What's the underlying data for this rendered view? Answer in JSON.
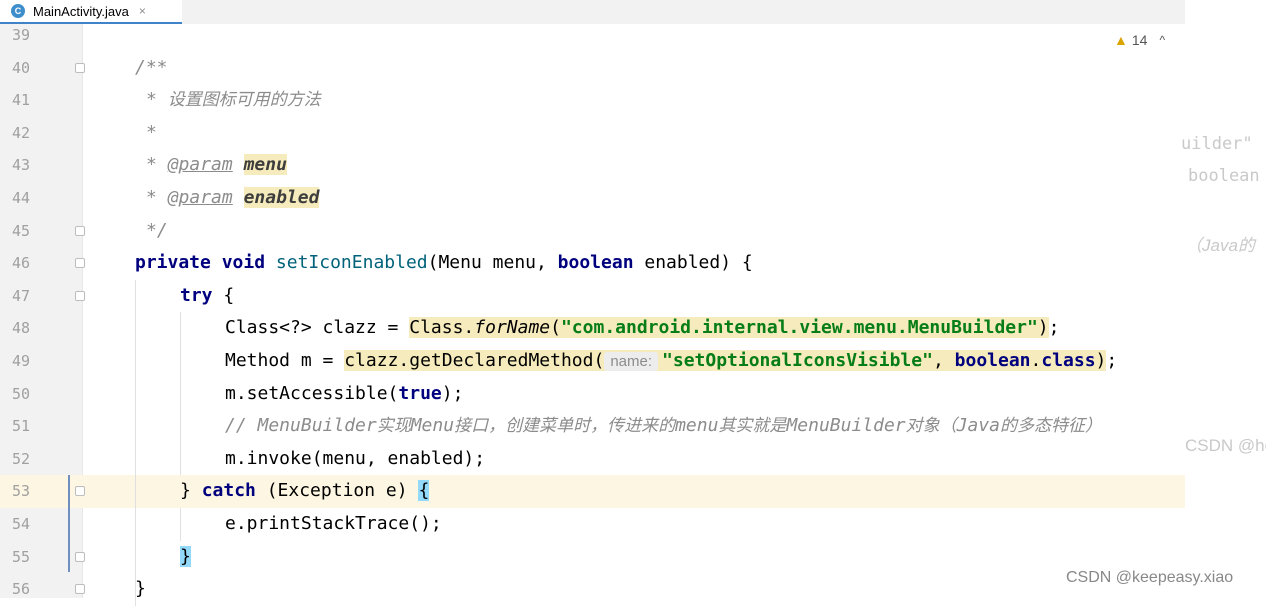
{
  "tab": {
    "icon": "C",
    "title": "MainActivity.java",
    "close": "×"
  },
  "inspection": {
    "icon": "warning-triangle-icon",
    "count": "14",
    "chevron": "^"
  },
  "watermark": "CSDN @keepeasy.xiao",
  "background_text": {
    "a": "uilder\"",
    "b": "boolean",
    "c": "（Java的",
    "d": "CSDN @hc"
  },
  "lines": [
    {
      "num": "39"
    },
    {
      "num": "40",
      "c1": "/**"
    },
    {
      "num": "41",
      "c1": "* ",
      "c2": "设置图标可用的方法"
    },
    {
      "num": "42",
      "c1": "*"
    },
    {
      "num": "43",
      "c1": "* ",
      "tag": "@param",
      "param": "menu"
    },
    {
      "num": "44",
      "c1": "* ",
      "tag": "@param",
      "param": "enabled"
    },
    {
      "num": "45",
      "c1": "*/"
    },
    {
      "num": "46",
      "kw1": "private",
      "kw2": "void",
      "method": "setIconEnabled",
      "rest1": "(Menu menu, ",
      "kw3": "boolean",
      "rest2": " enabled) {"
    },
    {
      "num": "47",
      "kw1": "try",
      "rest1": " {"
    },
    {
      "num": "48",
      "p1": "Class<?> clazz = ",
      "p2": "Class.",
      "p3": "forName",
      "p4": "(",
      "str": "\"com.android.internal.view.menu.MenuBuilder\"",
      "p5": ")",
      "p6": ";"
    },
    {
      "num": "49",
      "p1": "Method m = ",
      "p2": "clazz.getDeclaredMethod(",
      "hint": "name:",
      "str": "\"setOptionalIconsVisible\"",
      "p3": ", ",
      "kw": "boolean",
      "p4": ".",
      "kw2": "class",
      "p5": ")",
      "p6": ";"
    },
    {
      "num": "50",
      "p1": "m.setAccessible(",
      "kw": "true",
      "p2": ");"
    },
    {
      "num": "51",
      "c1": "// MenuBuilder",
      "c2": "实现",
      "c3": "Menu",
      "c4": "接口，创建菜单时，传进来的",
      "c5": "menu",
      "c6": "其实就是",
      "c7": "MenuBuilder",
      "c8": "对象（",
      "c9": "Java",
      "c10": "的多态特征）"
    },
    {
      "num": "52",
      "p1": "m.invoke(menu, enabled);"
    },
    {
      "num": "53",
      "p1": "} ",
      "kw": "catch",
      "p2": " (Exception e) ",
      "brace": "{"
    },
    {
      "num": "54",
      "p1": "e.printStackTrace();"
    },
    {
      "num": "55",
      "brace": "}"
    },
    {
      "num": "56",
      "p1": "}"
    }
  ]
}
